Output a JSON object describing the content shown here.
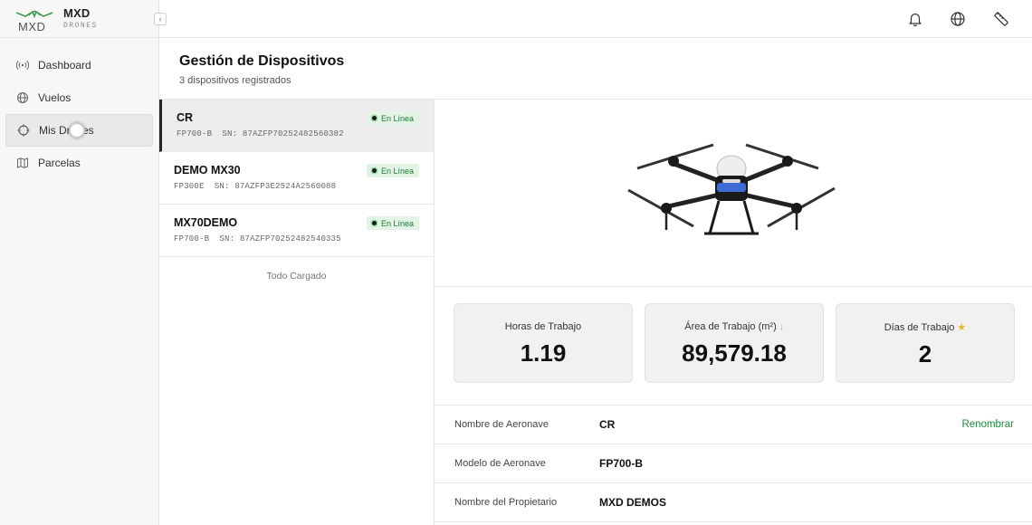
{
  "brand": {
    "name": "MXD",
    "sub": "DRONES"
  },
  "nav": {
    "items": [
      {
        "label": "Dashboard",
        "icon": "radio-signal-icon"
      },
      {
        "label": "Vuelos",
        "icon": "globe-icon"
      },
      {
        "label": "Mis Drones",
        "icon": "crosshair-icon",
        "active": true
      },
      {
        "label": "Parcelas",
        "icon": "map-icon"
      }
    ]
  },
  "topbar": {
    "icons": [
      "bell-icon",
      "globe-icon",
      "ruler-icon"
    ]
  },
  "header": {
    "title": "Gestión de Dispositivos",
    "subtitle": "3 dispositivos registrados"
  },
  "devices": [
    {
      "name": "CR",
      "model": "FP700-B",
      "sn_label": "SN:",
      "sn": "87AZFP70252482560382",
      "status": "En Línea"
    },
    {
      "name": "DEMO MX30",
      "model": "FP300E",
      "sn_label": "SN:",
      "sn": "87AZFP3E2524A2560088",
      "status": "En Línea"
    },
    {
      "name": "MX70DEMO",
      "model": "FP700-B",
      "sn_label": "SN:",
      "sn": "87AZFP70252482540335",
      "status": "En Línea"
    }
  ],
  "list_footer": "Todo Cargado",
  "stats": [
    {
      "label": "Horas de Trabajo",
      "value": "1.19"
    },
    {
      "label": "Área de Trabajo (m²)",
      "value": "89,579.18",
      "suffix": "↓"
    },
    {
      "label": "Días de Trabajo",
      "value": "2",
      "suffix": "★"
    }
  ],
  "info": {
    "name_label": "Nombre de Aeronave",
    "name_value": "CR",
    "rename": "Renombrar",
    "model_label": "Modelo de Aeronave",
    "model_value": "FP700-B",
    "owner_label": "Nombre del Propietario",
    "owner_value": "MXD DEMOS"
  },
  "colors": {
    "online_bg": "#e3f4e6",
    "online_text": "#1f7a36",
    "accent": "#1e8a3c"
  }
}
